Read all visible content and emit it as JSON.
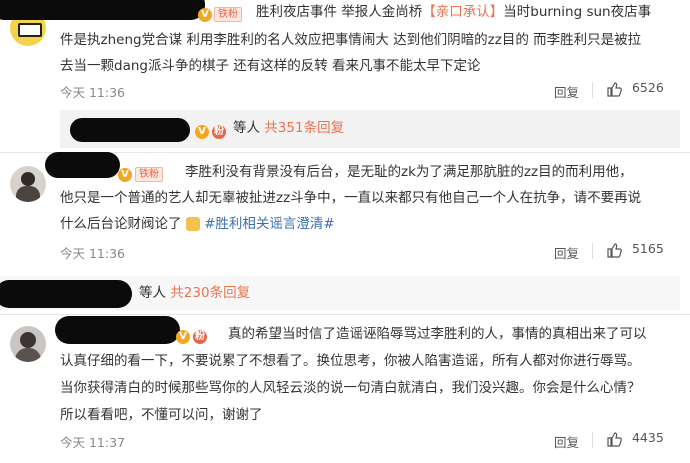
{
  "comments": [
    {
      "fan_badge": "铁粉",
      "lines": [
        "胜利夜店事件 举报人金尚桥",
        "【亲口承认】",
        "当时burning sun夜店事",
        "件是执zheng党合谋  利用李胜利的名人效应把事情闹大 达到他们阴暗的zz目的  而李胜利只是被拉",
        "去当一颗dang派斗争的棋子  还有这样的反转  看来凡事不能太早下定论"
      ],
      "time": "今天 11:36",
      "reply_label": "回复",
      "likes": "6526"
    },
    {
      "fan_badge": "铁粉",
      "lines": [
        "李胜利没有背景没有后台，是无耻的zk为了满足那肮脏的zz目的而利用他，",
        "他只是一个普通的艺人却无辜被扯进zz斗争中，一直以来都只有他自己一个人在抗争，请不要再说",
        "什么后台论财阀论了",
        "#胜利相关谣言澄清#"
      ],
      "time": "今天 11:36",
      "reply_label": "回复",
      "likes": "5165"
    },
    {
      "lines": [
        "真的希望当时信了造谣诬陷辱骂过李胜利的人，事情的真相出来了可以",
        "认真仔细的看一下，不要说累了不想看了。换位思考，你被人陷害造谣，所有人都对你进行辱骂。",
        "当你获得清白的时候那些骂你的人风轻云淡的说一句清白就清白，我们没兴趣。你会是什么心情？",
        "所以看看吧，不懂可以问，谢谢了"
      ],
      "time": "今天 11:37",
      "reply_label": "回复",
      "likes": "4435"
    }
  ],
  "reply_summaries": [
    {
      "suffix": "等人",
      "link": "共351条回复"
    },
    {
      "suffix": "等人",
      "link": "共230条回复"
    }
  ],
  "icons": {
    "like": "thumbs-up-icon",
    "reply": "reply-icon",
    "pray": "praying-hands-emoji"
  },
  "colors": {
    "link": "#eb7350",
    "topic": "#3a6fb5",
    "badge": "#f5a623"
  }
}
